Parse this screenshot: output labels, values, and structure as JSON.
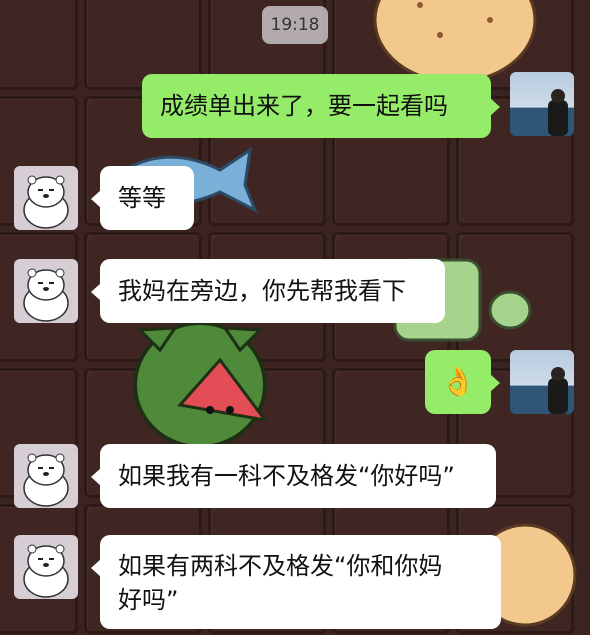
{
  "status": {
    "time": "19:18"
  },
  "colors": {
    "self_bubble": "#95ec69",
    "other_bubble": "#ffffff",
    "wallpaper": "#3a2320"
  },
  "contacts": {
    "self_avatar": "person-at-seaside-avatar",
    "other_avatar": "white-bear-avatar"
  },
  "messages": [
    {
      "sender": "self",
      "type": "text",
      "text": "成绩单出来了，要一起看吗"
    },
    {
      "sender": "other",
      "type": "text",
      "text": "等等"
    },
    {
      "sender": "other",
      "type": "text",
      "text": "我妈在旁边，你先帮我看下"
    },
    {
      "sender": "self",
      "type": "emoji",
      "icon": "ok-hand-icon",
      "glyph": "👌"
    },
    {
      "sender": "other",
      "type": "text",
      "text": "如果我有一科不及格发“你好吗”"
    },
    {
      "sender": "other",
      "type": "text",
      "text": "如果有两科不及格发“你和你妈\n好吗”"
    }
  ]
}
